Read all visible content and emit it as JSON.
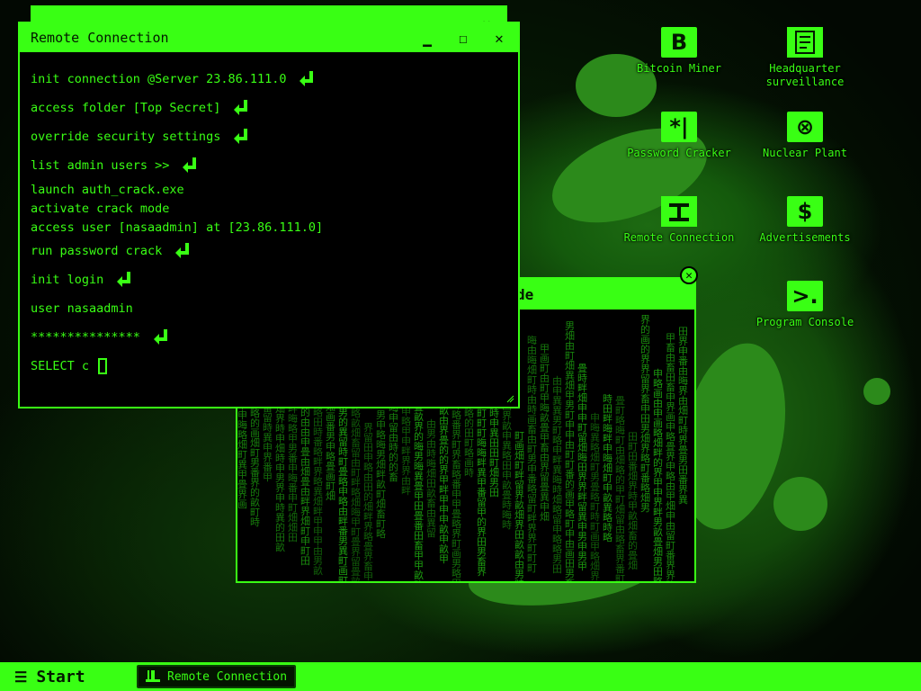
{
  "desktop_icons": [
    {
      "label": "Bitcoin Miner",
      "glyph": "B",
      "icon": "bitcoin-icon"
    },
    {
      "label": "Headquarter surveillance",
      "glyph": "",
      "icon": "surveillance-icon"
    },
    {
      "label": "Password Cracker",
      "glyph": "*|",
      "icon": "password-cracker-icon"
    },
    {
      "label": "Nuclear Plant",
      "glyph": "⊗",
      "icon": "nuclear-icon"
    },
    {
      "label": "Remote Connection",
      "glyph": "",
      "icon": "remote-connection-icon"
    },
    {
      "label": "Advertisements",
      "glyph": "$",
      "icon": "dollar-icon"
    },
    {
      "label": "Program Console",
      "glyph": ">.",
      "icon": "console-icon"
    }
  ],
  "back_window": {
    "title_fragment": "de"
  },
  "terminal": {
    "title": "Remote Connection",
    "lines": [
      {
        "text": "init connection @Server 23.86.111.0",
        "enter": true
      },
      {
        "text": "access folder [Top Secret]",
        "enter": true
      },
      {
        "text": "override security settings",
        "enter": true
      },
      {
        "text": "list admin users >>",
        "enter": true
      },
      {
        "text": "launch auth_crack.exe",
        "enter": false
      },
      {
        "text": "activate crack mode",
        "enter": false
      },
      {
        "text": "access user [nasaadmin] at [23.86.111.0]",
        "enter": false
      },
      {
        "text": "run password crack",
        "enter": true
      },
      {
        "text": "init login",
        "enter": true
      },
      {
        "text": "user nasaadmin",
        "enter": false
      },
      {
        "text": "***************",
        "enter": true
      }
    ],
    "prompt": "SELECT c"
  },
  "taskbar": {
    "start_label": "Start",
    "open_task": "Remote Connection"
  },
  "colors": {
    "neon": "#39ff14",
    "dark": "#021800",
    "matrix": "#1d9e10"
  }
}
